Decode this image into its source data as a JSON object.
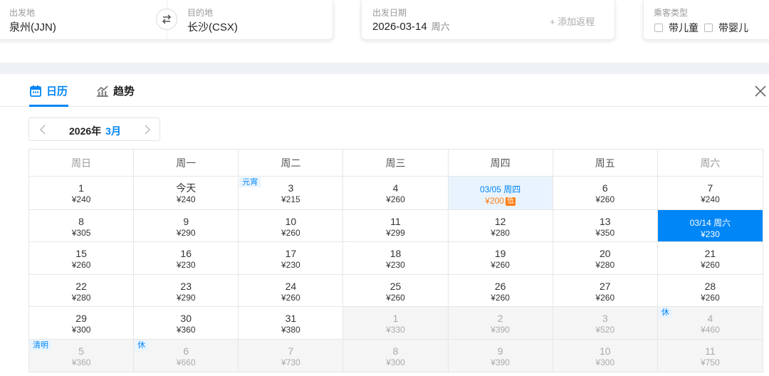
{
  "search": {
    "from_label": "出发地",
    "from_value": "泉州(JJN)",
    "to_label": "目的地",
    "to_value": "长沙(CSX)",
    "date_label": "出发日期",
    "date_value": "2026-03-14",
    "date_weekday": "周六",
    "add_return": "+ 添加返程",
    "pax_label": "乘客类型",
    "pax_child": "带儿童",
    "pax_infant": "带婴儿"
  },
  "tabs": {
    "calendar": "日历",
    "trend": "趋势",
    "active": "calendar"
  },
  "month_nav": {
    "year": "2026年",
    "month": "3月"
  },
  "weekdays": [
    "周日",
    "周一",
    "周二",
    "周三",
    "周四",
    "周五",
    "周六"
  ],
  "colors": {
    "accent": "#0086f6",
    "low_price": "#ff7d13",
    "other_month_bg": "#f5f5f5",
    "low_bg": "#e8f3fd"
  },
  "weeks": [
    [
      {
        "day": "1",
        "price": "¥240"
      },
      {
        "day": "今天",
        "price": "¥240"
      },
      {
        "day": "3",
        "price": "¥215",
        "tag": "元宵"
      },
      {
        "day": "4",
        "price": "¥260"
      },
      {
        "day": "03/05 周四",
        "price": "¥200",
        "state": "low",
        "badge": "低"
      },
      {
        "day": "6",
        "price": "¥260"
      },
      {
        "day": "7",
        "price": "¥240"
      }
    ],
    [
      {
        "day": "8",
        "price": "¥305"
      },
      {
        "day": "9",
        "price": "¥290"
      },
      {
        "day": "10",
        "price": "¥260"
      },
      {
        "day": "11",
        "price": "¥299"
      },
      {
        "day": "12",
        "price": "¥280"
      },
      {
        "day": "13",
        "price": "¥350"
      },
      {
        "day": "03/14 周六",
        "price": "¥230",
        "state": "selected"
      }
    ],
    [
      {
        "day": "15",
        "price": "¥260"
      },
      {
        "day": "16",
        "price": "¥230"
      },
      {
        "day": "17",
        "price": "¥230"
      },
      {
        "day": "18",
        "price": "¥230"
      },
      {
        "day": "19",
        "price": "¥260"
      },
      {
        "day": "20",
        "price": "¥280"
      },
      {
        "day": "21",
        "price": "¥260"
      }
    ],
    [
      {
        "day": "22",
        "price": "¥280"
      },
      {
        "day": "23",
        "price": "¥290"
      },
      {
        "day": "24",
        "price": "¥260"
      },
      {
        "day": "25",
        "price": "¥260"
      },
      {
        "day": "26",
        "price": "¥260"
      },
      {
        "day": "27",
        "price": "¥260"
      },
      {
        "day": "28",
        "price": "¥260"
      }
    ],
    [
      {
        "day": "29",
        "price": "¥300"
      },
      {
        "day": "30",
        "price": "¥360"
      },
      {
        "day": "31",
        "price": "¥380"
      },
      {
        "day": "1",
        "price": "¥330",
        "state": "other"
      },
      {
        "day": "2",
        "price": "¥390",
        "state": "other"
      },
      {
        "day": "3",
        "price": "¥520",
        "state": "other"
      },
      {
        "day": "4",
        "price": "¥460",
        "state": "other",
        "tag": "休"
      }
    ],
    [
      {
        "day": "5",
        "price": "¥360",
        "state": "other",
        "tag": "清明"
      },
      {
        "day": "6",
        "price": "¥660",
        "state": "other",
        "tag": "休"
      },
      {
        "day": "7",
        "price": "¥730",
        "state": "other"
      },
      {
        "day": "8",
        "price": "¥300",
        "state": "other"
      },
      {
        "day": "9",
        "price": "¥390",
        "state": "other"
      },
      {
        "day": "10",
        "price": "¥300",
        "state": "other"
      },
      {
        "day": "11",
        "price": "¥750",
        "state": "other"
      }
    ]
  ]
}
